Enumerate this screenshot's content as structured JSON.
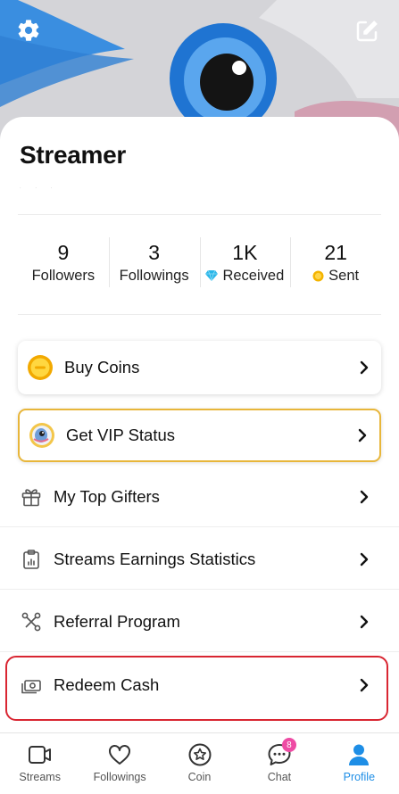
{
  "header": {
    "settings_icon": "gear-icon",
    "edit_icon": "edit-icon"
  },
  "profile": {
    "name": "Streamer",
    "sub_text": ". . ."
  },
  "stats": [
    {
      "value": "9",
      "label": "Followers",
      "icon": ""
    },
    {
      "value": "3",
      "label": "Followings",
      "icon": ""
    },
    {
      "value": "1K",
      "label": "Received",
      "icon": "diamond-icon"
    },
    {
      "value": "21",
      "label": "Sent",
      "icon": "coin-icon"
    }
  ],
  "menu": {
    "buy_coins": "Buy Coins",
    "vip": "Get VIP Status",
    "top_gifters": "My Top Gifters",
    "earnings": "Streams Earnings Statistics",
    "referral": "Referral Program",
    "redeem": "Redeem Cash"
  },
  "nav": {
    "streams": "Streams",
    "followings": "Followings",
    "coin": "Coin",
    "chat": "Chat",
    "chat_badge": "8",
    "profile": "Profile"
  },
  "colors": {
    "accent": "#1e8ee6",
    "vip_border": "#e8b63a",
    "highlight": "#d92632",
    "badge": "#ee4ba4"
  }
}
